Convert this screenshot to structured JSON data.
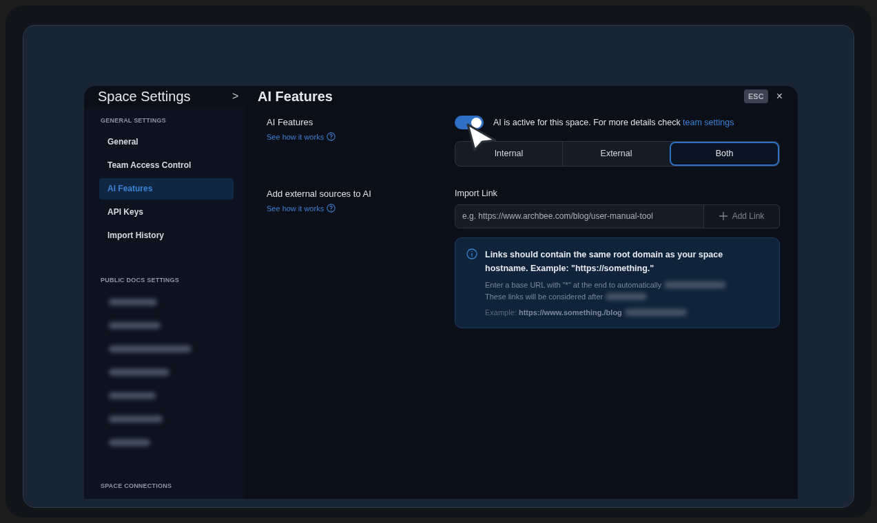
{
  "header": {
    "title": "Space Settings",
    "separator": ">",
    "page": "AI Features",
    "esc": "ESC",
    "close": "×"
  },
  "sidebar": {
    "sections": [
      {
        "kind": "list",
        "heading": "GENERAL SETTINGS",
        "items": [
          {
            "label": "General",
            "selected": false
          },
          {
            "label": "Team Access Control",
            "selected": false
          },
          {
            "label": "AI Features",
            "selected": true
          },
          {
            "label": "API Keys",
            "selected": false
          },
          {
            "label": "Import History",
            "selected": false
          }
        ]
      },
      {
        "kind": "blurred",
        "heading": "PUBLIC DOCS SETTINGS"
      },
      {
        "kind": "heading",
        "heading": "SPACE CONNECTIONS"
      }
    ]
  },
  "settings": [
    {
      "kind": "toggle",
      "label": "AI Features",
      "help": "See how it works",
      "on": true,
      "text": "AI is active for this space. For more details check ",
      "link": "team settings",
      "options": [
        {
          "label": "Internal",
          "selected": false
        },
        {
          "label": "External",
          "selected": false
        },
        {
          "label": "Both",
          "selected": true
        }
      ]
    },
    {
      "kind": "import",
      "label": "Add external sources to AI",
      "help": "See how it works",
      "field_label": "Import Link",
      "placeholder": "e.g. https://www.archbee.com/blog/user-manual-tool",
      "button": "Add Link",
      "info_title": "Links should contain the same root domain as your space hostname. Example: \"https://something.\"",
      "info_lines": [
        "Enter a base URL with \"*\" at the end to automatically",
        "These links will be considered after"
      ],
      "example_label": "Example:",
      "example_url": "https://www.something./blog"
    }
  ]
}
